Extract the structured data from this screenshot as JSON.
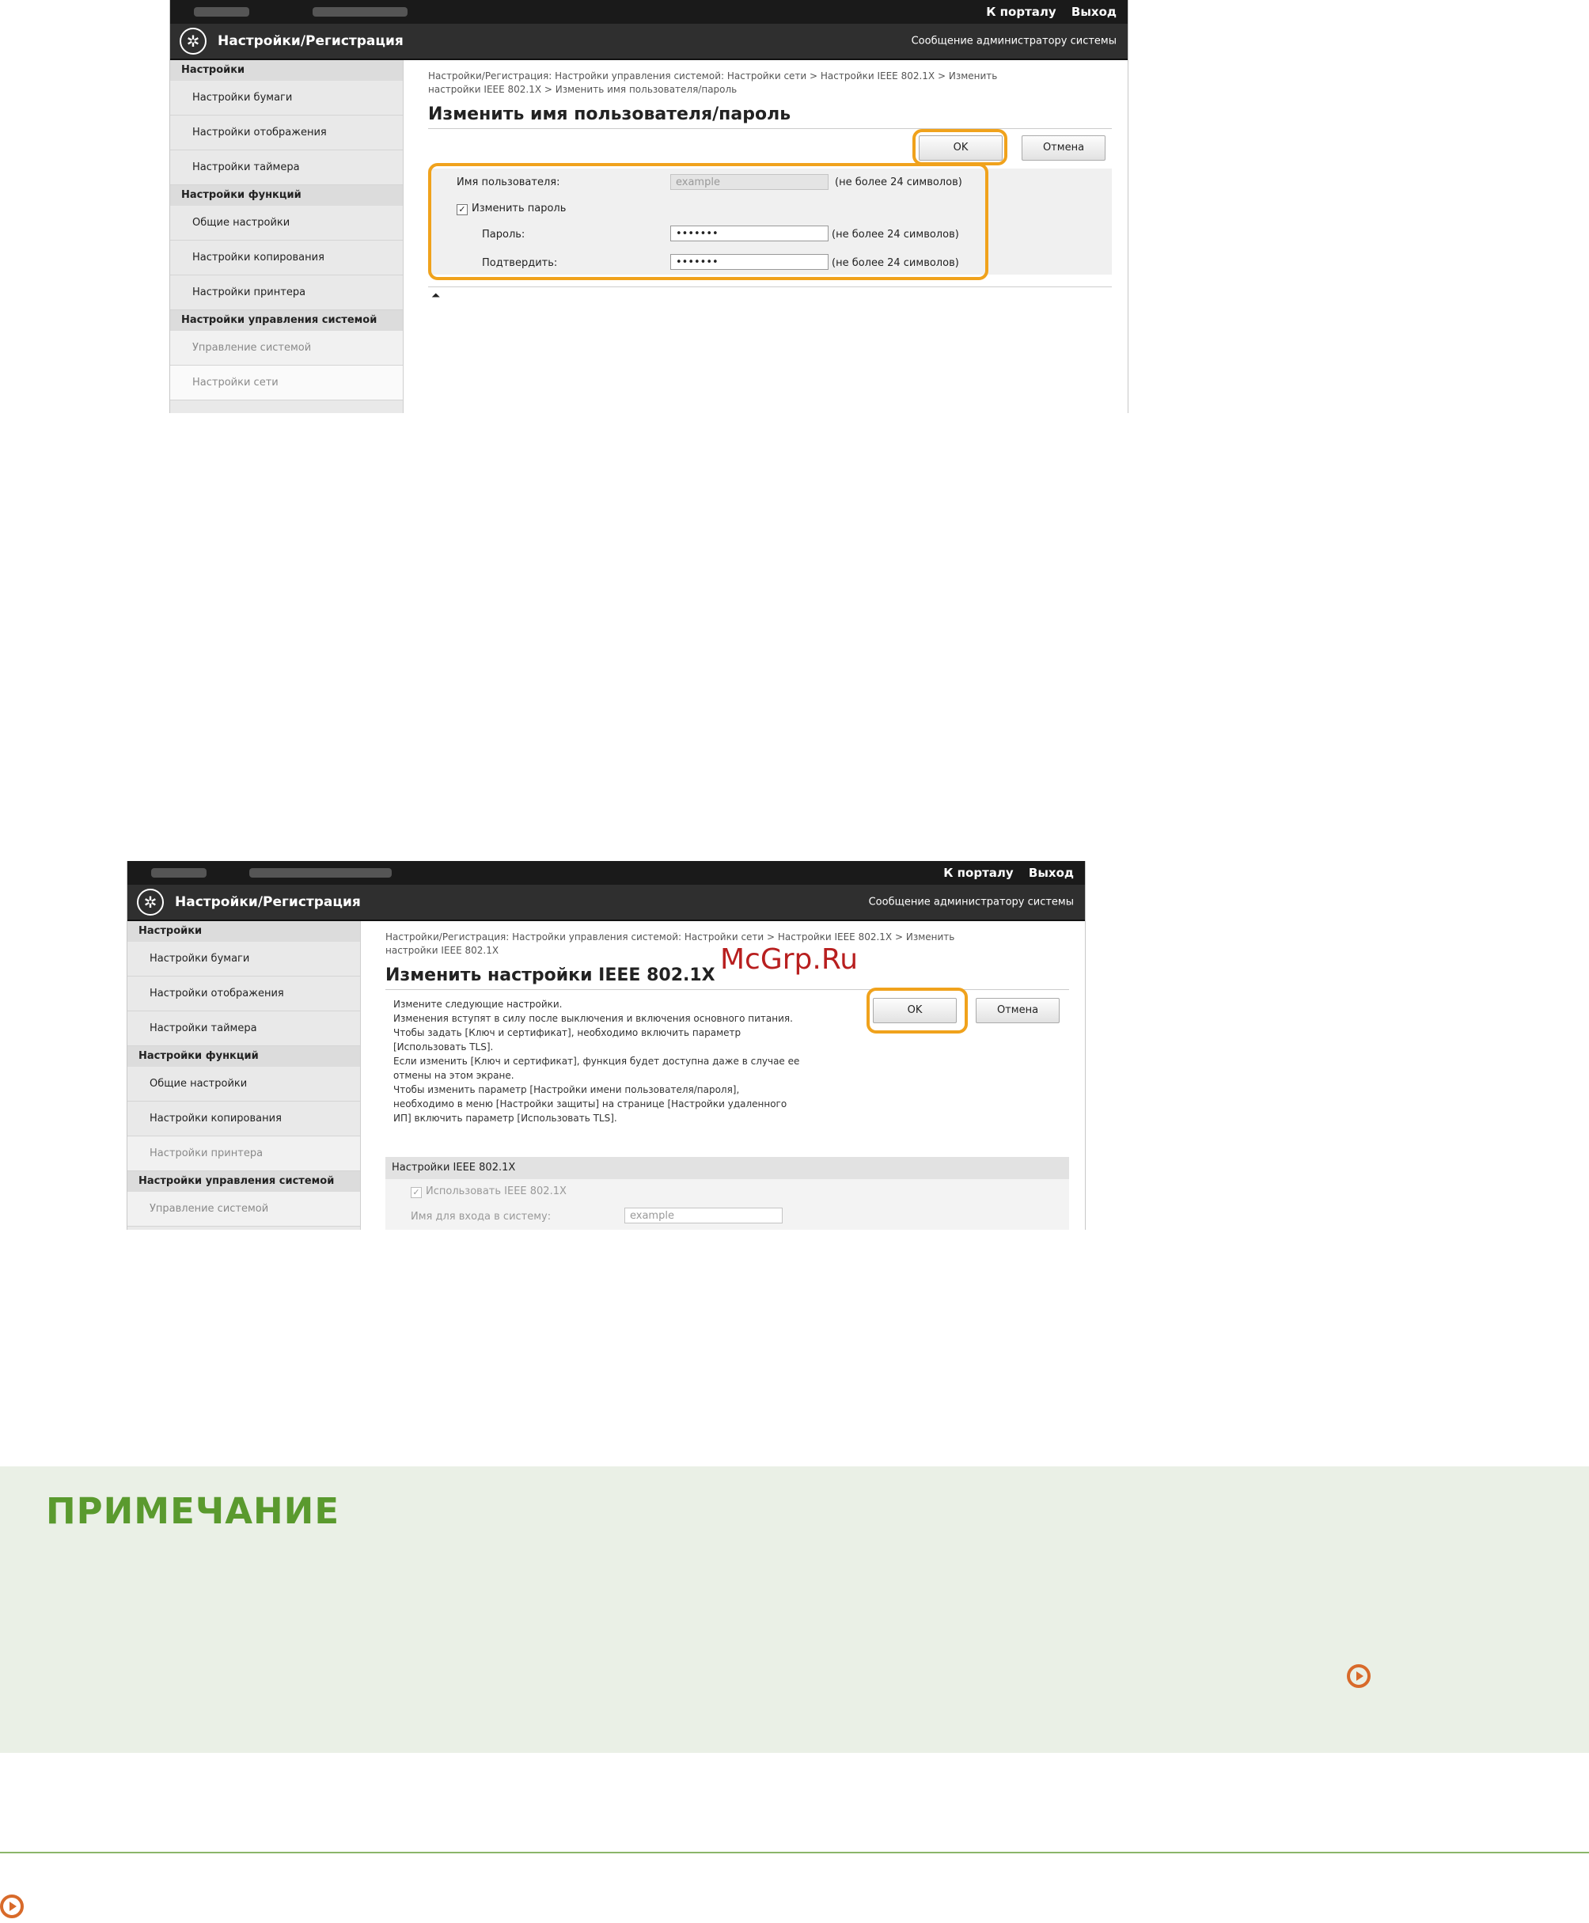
{
  "screenshot1": {
    "top_links": [
      "К порталу",
      "Выход"
    ],
    "title": "Настройки/Регистрация",
    "admin_message": "Сообщение администратору системы",
    "sidebar": [
      {
        "type": "section",
        "label": "Настройки"
      },
      {
        "type": "item",
        "label": "Настройки бумаги"
      },
      {
        "type": "item",
        "label": "Настройки отображения"
      },
      {
        "type": "item",
        "label": "Настройки таймера"
      },
      {
        "type": "section",
        "label": "Настройки функций"
      },
      {
        "type": "item",
        "label": "Общие настройки"
      },
      {
        "type": "item",
        "label": "Настройки копирования"
      },
      {
        "type": "item",
        "label": "Настройки принтера"
      },
      {
        "type": "section",
        "label": "Настройки управления системой"
      },
      {
        "type": "item",
        "label": "Управление системой",
        "state": "dim"
      },
      {
        "type": "item",
        "label": "Настройки сети",
        "state": "selected"
      }
    ],
    "breadcrumb_line1": "Настройки/Регистрация: Настройки управления системой: Настройки сети > Настройки IEEE 802.1X > Изменить",
    "breadcrumb_line2": "настройки IEEE 802.1X > Изменить имя пользователя/пароль",
    "heading": "Изменить имя пользователя/пароль",
    "ok_label": "OK",
    "cancel_label": "Отмена",
    "form": {
      "username_label": "Имя пользователя:",
      "username_value": "example",
      "username_hint": "(не более 24 символов)",
      "change_password_label": "Изменить пароль",
      "change_password_checked": true,
      "password_label": "Пароль:",
      "password_value": "•••••••",
      "password_hint": "(не более 24 символов)",
      "confirm_label": "Подтвердить:",
      "confirm_value": "•••••••",
      "confirm_hint": "(не более 24 символов)"
    },
    "to_top_glyph": "⏶"
  },
  "screenshot2": {
    "top_links": [
      "К порталу",
      "Выход"
    ],
    "title": "Настройки/Регистрация",
    "admin_message": "Сообщение администратору системы",
    "sidebar": [
      {
        "type": "section",
        "label": "Настройки"
      },
      {
        "type": "item",
        "label": "Настройки бумаги"
      },
      {
        "type": "item",
        "label": "Настройки отображения"
      },
      {
        "type": "item",
        "label": "Настройки таймера"
      },
      {
        "type": "section",
        "label": "Настройки функций"
      },
      {
        "type": "item",
        "label": "Общие настройки"
      },
      {
        "type": "item",
        "label": "Настройки копирования"
      },
      {
        "type": "item",
        "label": "Настройки принтера",
        "state": "dim"
      },
      {
        "type": "section",
        "label": "Настройки управления системой"
      },
      {
        "type": "item",
        "label": "Управление системой",
        "state": "dim"
      }
    ],
    "breadcrumb_line1": "Настройки/Регистрация: Настройки управления системой: Настройки сети > Настройки IEEE 802.1X > Изменить",
    "breadcrumb_line2": "настройки IEEE 802.1X",
    "heading": "Изменить настройки IEEE 802.1X",
    "ok_label": "OK",
    "cancel_label": "Отмена",
    "info_lines": [
      "Измените следующие настройки.",
      "Изменения вступят в силу после выключения и включения основного питания.",
      "Чтобы задать [Ключ и сертификат], необходимо включить параметр",
      "[Использовать TLS].",
      "Если изменить [Ключ и сертификат], функция будет доступна даже в случае ее",
      "отмены на этом экране.",
      "Чтобы изменить параметр [Настройки имени пользователя/пароля],",
      "необходимо в меню [Настройки защиты] на странице [Настройки удаленного",
      "ИП] включить параметр [Использовать TLS]."
    ],
    "section_header": "Настройки IEEE 802.1X",
    "use_ieee_label": "Использовать IEEE 802.1X",
    "login_label": "Имя для входа в систему:",
    "login_value": "example"
  },
  "watermark": "McGrp.Ru",
  "note": {
    "heading": "ПРИМЕЧАНИЕ"
  },
  "colors": {
    "highlight": "#f0a21c",
    "note_bg": "#eaf0e6",
    "note_heading": "#5a9a2e",
    "link_icon": "#d86a2a"
  }
}
